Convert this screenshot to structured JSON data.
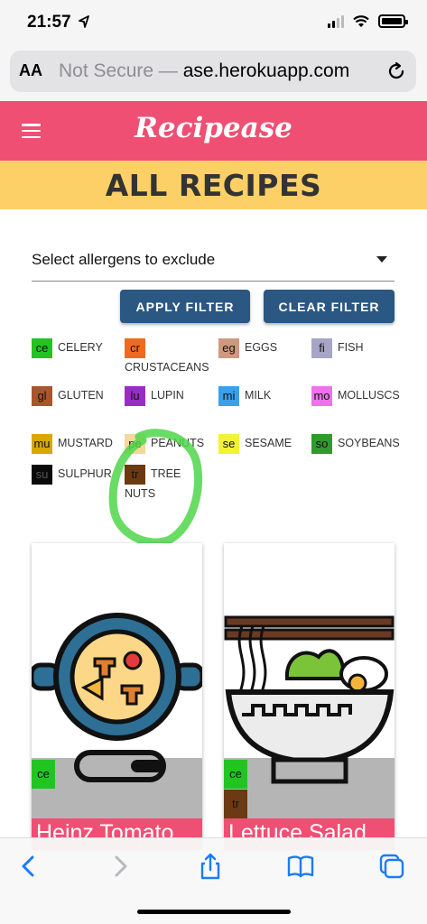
{
  "status_bar": {
    "time": "21:57"
  },
  "browser": {
    "aa_label": "AA",
    "not_secure": "Not Secure —",
    "domain": "ase.herokuapp.com"
  },
  "header": {
    "brand": "Recipease",
    "page_title": "ALL RECIPES"
  },
  "filter": {
    "select_label": "Select allergens to exclude",
    "apply_label": "APPLY FILTER",
    "clear_label": "CLEAR FILTER"
  },
  "allergens": [
    {
      "code": "ce",
      "name": "CELERY",
      "color": "#22c422"
    },
    {
      "code": "cr",
      "name": "CRUSTACEANS",
      "color": "#ee6a1f"
    },
    {
      "code": "eg",
      "name": "EGGS",
      "color": "#cf9980"
    },
    {
      "code": "fi",
      "name": "FISH",
      "color": "#a7a5c6"
    },
    {
      "code": "gl",
      "name": "GLUTEN",
      "color": "#a9552d"
    },
    {
      "code": "lu",
      "name": "LUPIN",
      "color": "#9a2cc5"
    },
    {
      "code": "mi",
      "name": "MILK",
      "color": "#3aa0ec"
    },
    {
      "code": "mo",
      "name": "MOLLUSCS",
      "color": "#ee71ee"
    },
    {
      "code": "mu",
      "name": "MUSTARD",
      "color": "#d6a800"
    },
    {
      "code": "pe",
      "name": "PEANUTS",
      "color": "#f3d79d"
    },
    {
      "code": "se",
      "name": "SESAME",
      "color": "#f2f236"
    },
    {
      "code": "so",
      "name": "SOYBEANS",
      "color": "#2f9a2f"
    },
    {
      "code": "su",
      "name": "SULPHUR",
      "color": "#0a0a0a"
    },
    {
      "code": "tr",
      "name": "TREE NUTS",
      "color": "#6b3a12"
    }
  ],
  "recipes": [
    {
      "title": "Heinz Tomato",
      "allergens": [
        "ce"
      ]
    },
    {
      "title": "Lettuce Salad",
      "allergens": [
        "ce",
        "tr"
      ]
    }
  ]
}
